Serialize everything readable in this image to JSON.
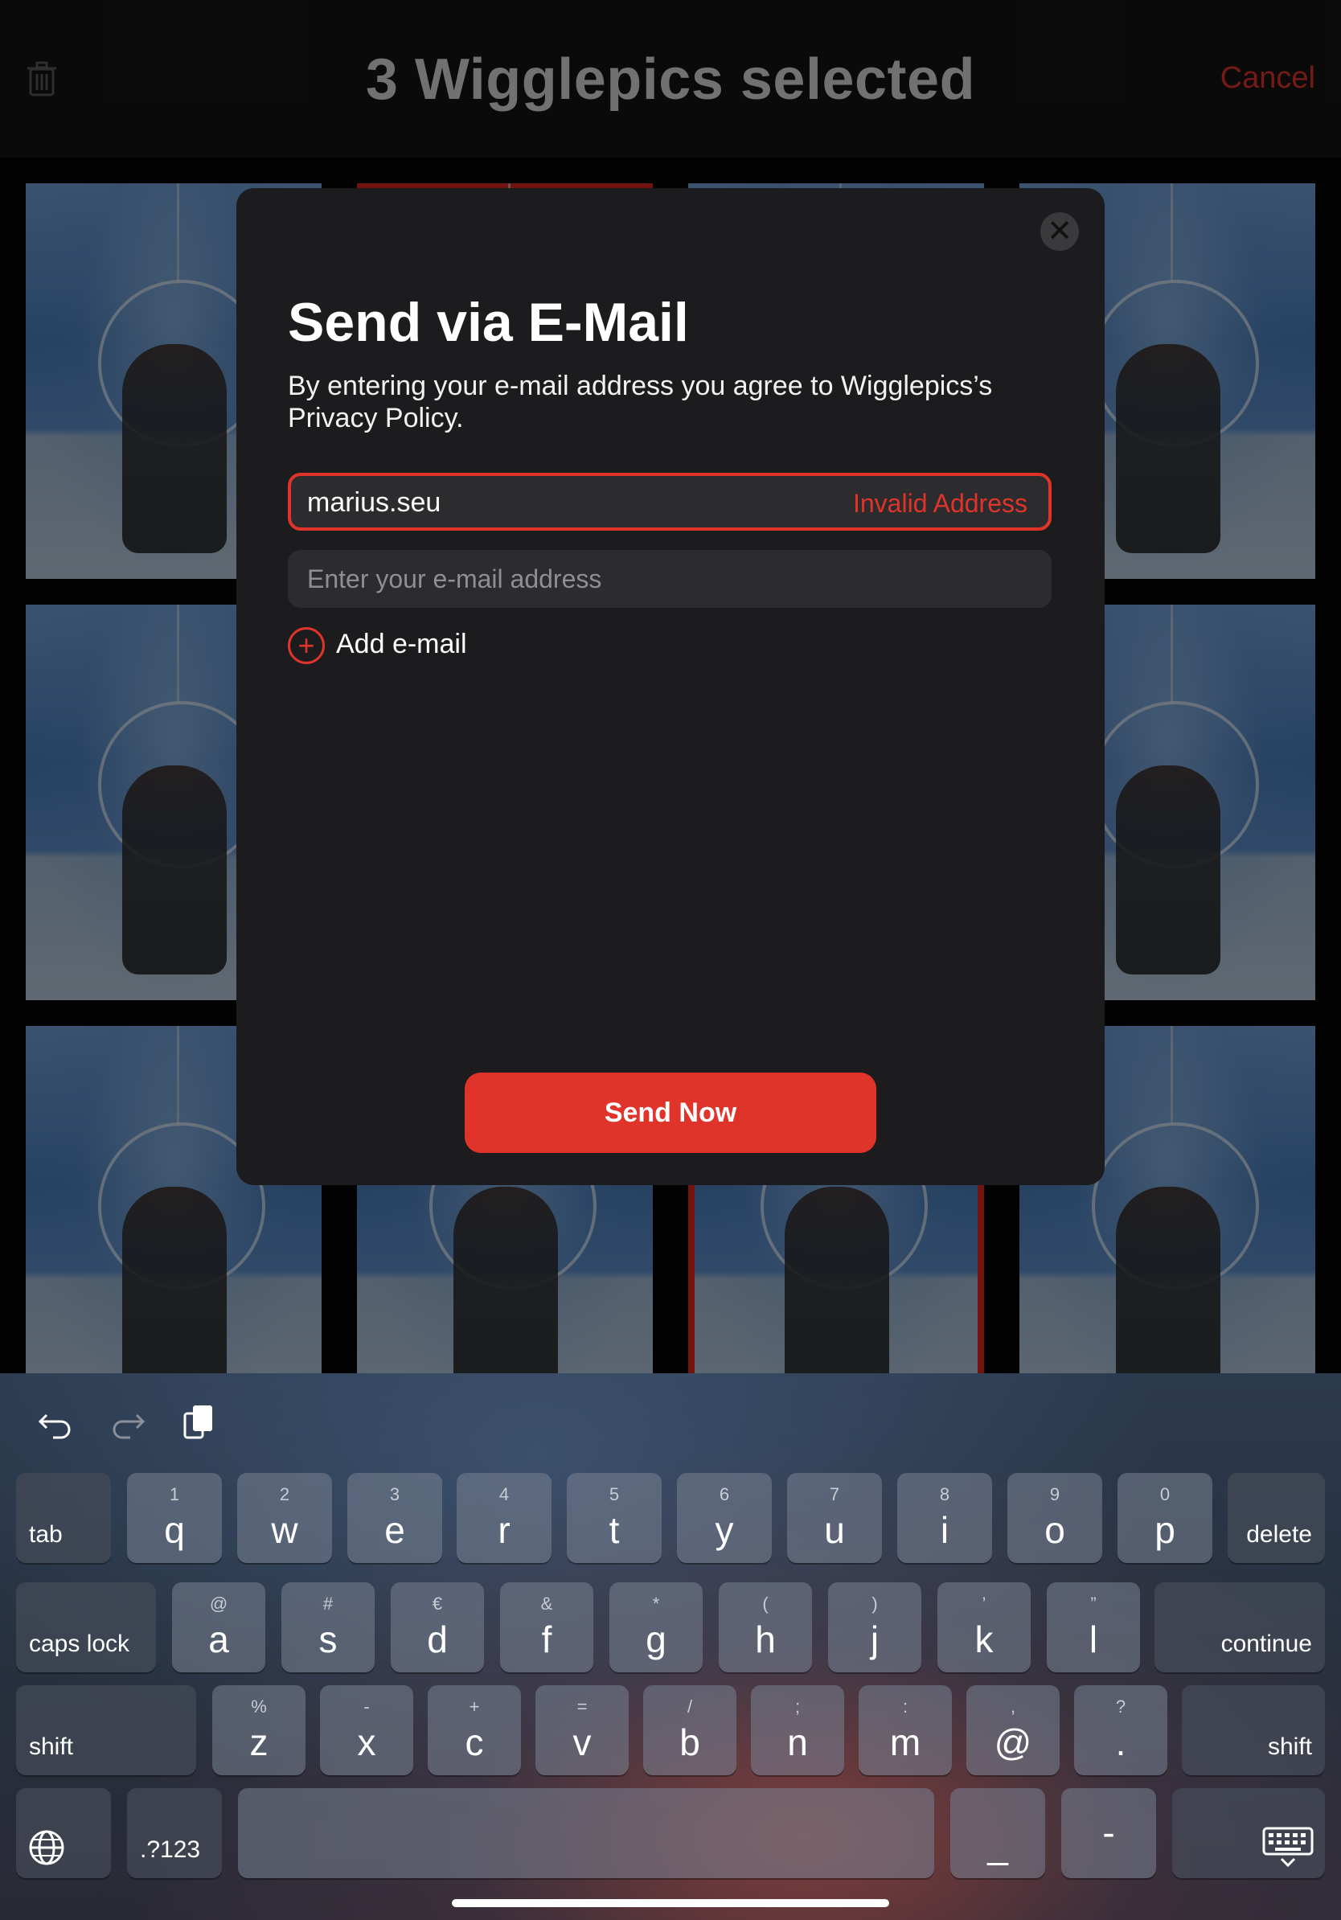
{
  "header": {
    "title": "3 Wigglepics selected",
    "cancel_label": "Cancel",
    "trash_icon": "trash-icon"
  },
  "gallery": {
    "selected_count": 3,
    "accent_color": "#d8261c"
  },
  "modal": {
    "title": "Send via E-Mail",
    "description": "By entering your e-mail address you agree to Wigglepics’s Privacy Policy.",
    "email_1": {
      "value": "marius.seu",
      "error": "Invalid Address"
    },
    "email_2": {
      "placeholder": "Enter your e-mail address"
    },
    "add_email_label": "Add e-mail",
    "send_label": "Send Now",
    "close_icon": "close-icon"
  },
  "keyboard": {
    "row1": [
      {
        "main": "q",
        "sub": "1"
      },
      {
        "main": "w",
        "sub": "2"
      },
      {
        "main": "e",
        "sub": "3"
      },
      {
        "main": "r",
        "sub": "4"
      },
      {
        "main": "t",
        "sub": "5"
      },
      {
        "main": "y",
        "sub": "6"
      },
      {
        "main": "u",
        "sub": "7"
      },
      {
        "main": "i",
        "sub": "8"
      },
      {
        "main": "o",
        "sub": "9"
      },
      {
        "main": "p",
        "sub": "0"
      }
    ],
    "row2": [
      {
        "main": "a",
        "sub": "@"
      },
      {
        "main": "s",
        "sub": "#"
      },
      {
        "main": "d",
        "sub": "€"
      },
      {
        "main": "f",
        "sub": "&"
      },
      {
        "main": "g",
        "sub": "*"
      },
      {
        "main": "h",
        "sub": "("
      },
      {
        "main": "j",
        "sub": ")"
      },
      {
        "main": "k",
        "sub": "’"
      },
      {
        "main": "l",
        "sub": "”"
      }
    ],
    "row3": [
      {
        "main": "z",
        "sub": "%"
      },
      {
        "main": "x",
        "sub": "-"
      },
      {
        "main": "c",
        "sub": "+"
      },
      {
        "main": "v",
        "sub": "="
      },
      {
        "main": "b",
        "sub": "/"
      },
      {
        "main": "n",
        "sub": ";"
      },
      {
        "main": "m",
        "sub": ":"
      },
      {
        "main": "@",
        "sub": ","
      },
      {
        "main": ".",
        "sub": "?"
      }
    ],
    "tab": "tab",
    "delete": "delete",
    "caps_lock": "caps lock",
    "continue": "continue",
    "shift": "shift",
    "numbers": ".?123",
    "underscore": "_",
    "dash": "-"
  }
}
